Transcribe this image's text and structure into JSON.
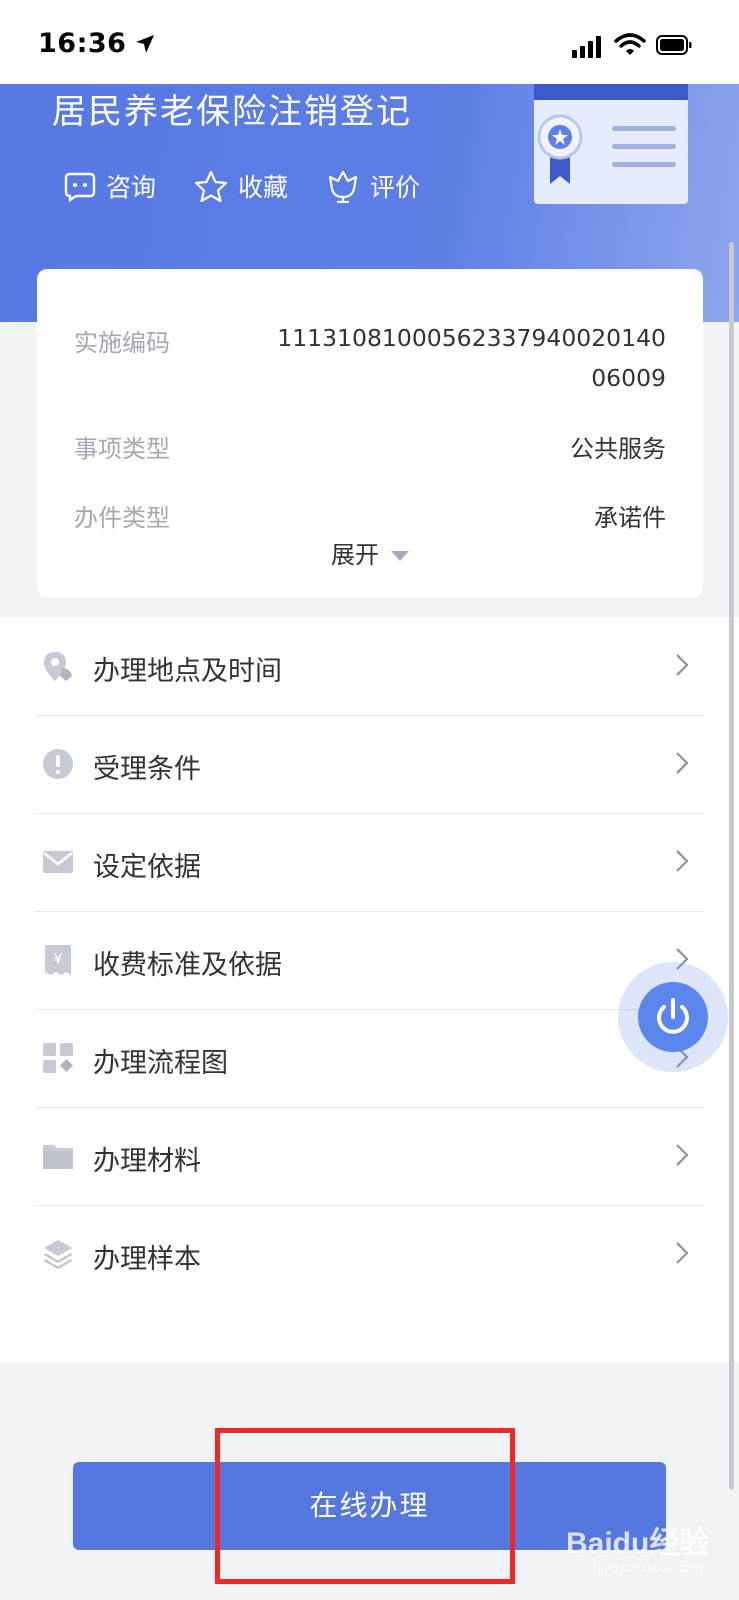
{
  "status_bar": {
    "time": "16:36"
  },
  "banner": {
    "title": "居民养老保险注销登记",
    "actions": [
      {
        "label": "咨询",
        "icon": "chat-icon"
      },
      {
        "label": "收藏",
        "icon": "star-icon"
      },
      {
        "label": "评价",
        "icon": "flower-icon"
      }
    ]
  },
  "info": {
    "rows": [
      {
        "label": "实施编码",
        "value": "11131081000562337940020140 06009"
      },
      {
        "label": "事项类型",
        "value": "公共服务"
      },
      {
        "label": "办件类型",
        "value": "承诺件"
      }
    ],
    "expand_label": "展开"
  },
  "menu": {
    "items": [
      {
        "label": "办理地点及时间",
        "icon": "location-pin-icon"
      },
      {
        "label": "受理条件",
        "icon": "exclamation-icon"
      },
      {
        "label": "设定依据",
        "icon": "envelope-icon"
      },
      {
        "label": "收费标准及依据",
        "icon": "yuan-receipt-icon"
      },
      {
        "label": "办理流程图",
        "icon": "flowchart-icon"
      },
      {
        "label": "办理材料",
        "icon": "folder-icon"
      },
      {
        "label": "办理样本",
        "icon": "layers-icon"
      }
    ]
  },
  "submit_button": {
    "label": "在线办理"
  },
  "watermark": {
    "brand": "Baidu经验",
    "url": "jingyan.baidu.com"
  },
  "colors": {
    "accent": "#5578e0",
    "banner": "#5678e3",
    "highlight_box": "#ef2727"
  }
}
